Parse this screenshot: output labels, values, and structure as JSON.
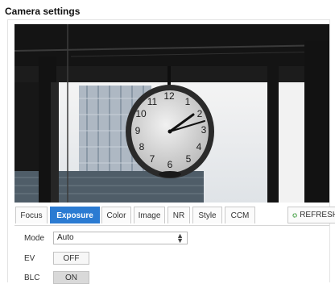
{
  "header": {
    "title": "Camera settings"
  },
  "tabs": [
    {
      "label": "Focus",
      "active": false
    },
    {
      "label": "Exposure",
      "active": true
    },
    {
      "label": "Color",
      "active": false
    },
    {
      "label": "Image",
      "active": false
    },
    {
      "label": "NR",
      "active": false
    },
    {
      "label": "Style",
      "active": false
    },
    {
      "label": "CCM",
      "active": false
    }
  ],
  "refresh": {
    "label": "REFRESH",
    "icon": "refresh-icon",
    "icon_color": "#3a9b3a"
  },
  "accent_color": "#2b7bd2",
  "settings": {
    "mode": {
      "label": "Mode",
      "value": "Auto"
    },
    "ev": {
      "label": "EV",
      "value": "OFF"
    },
    "blc": {
      "label": "BLC",
      "value": "ON"
    }
  },
  "preview": {
    "content": "live-camera-preview-of-wall-clock"
  }
}
